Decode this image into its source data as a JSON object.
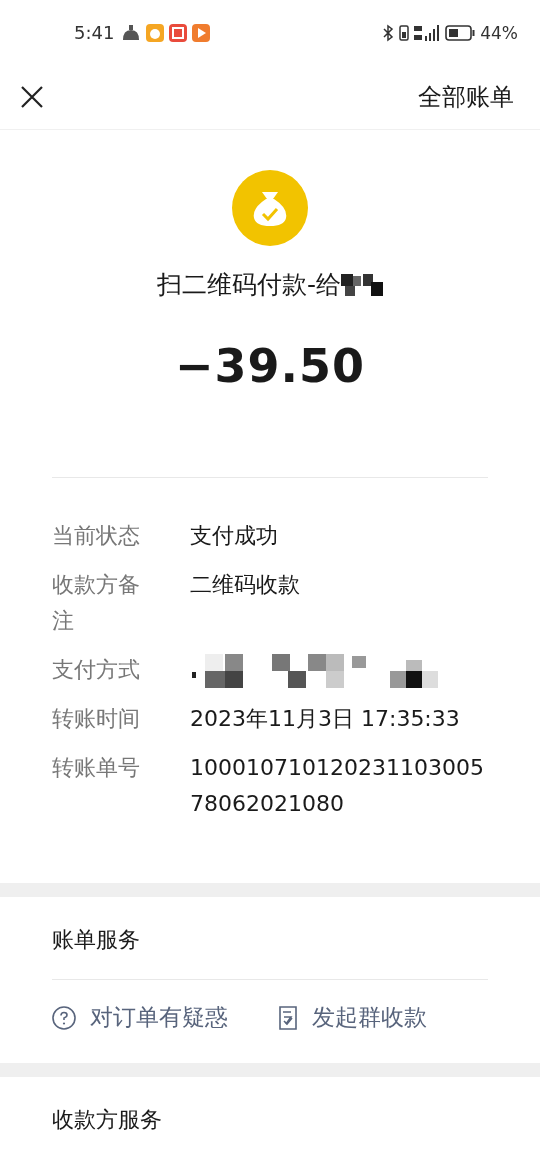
{
  "status_bar": {
    "time": "5:41",
    "battery": "44%"
  },
  "header": {
    "right_link": "全部账单"
  },
  "bill": {
    "title": "扫二维码付款-给",
    "title_redacted": true,
    "amount": "−39.50"
  },
  "details": [
    {
      "label": "当前状态",
      "value": "支付成功",
      "kind": "text"
    },
    {
      "label": "收款方备注",
      "value": "二维码收款",
      "kind": "text"
    },
    {
      "label": "支付方式",
      "kind": "redacted"
    },
    {
      "label": "转账时间",
      "value": "2023年11月3日 17:35:33",
      "kind": "text"
    },
    {
      "label": "转账单号",
      "value": "10001071012023110300578062021080",
      "kind": "text"
    }
  ],
  "sections": [
    {
      "title": "账单服务",
      "actions": [
        {
          "label": "对订单有疑惑",
          "kind": "question"
        },
        {
          "label": "发起群收款",
          "kind": "receipt"
        }
      ]
    },
    {
      "title": "收款方服务"
    }
  ]
}
